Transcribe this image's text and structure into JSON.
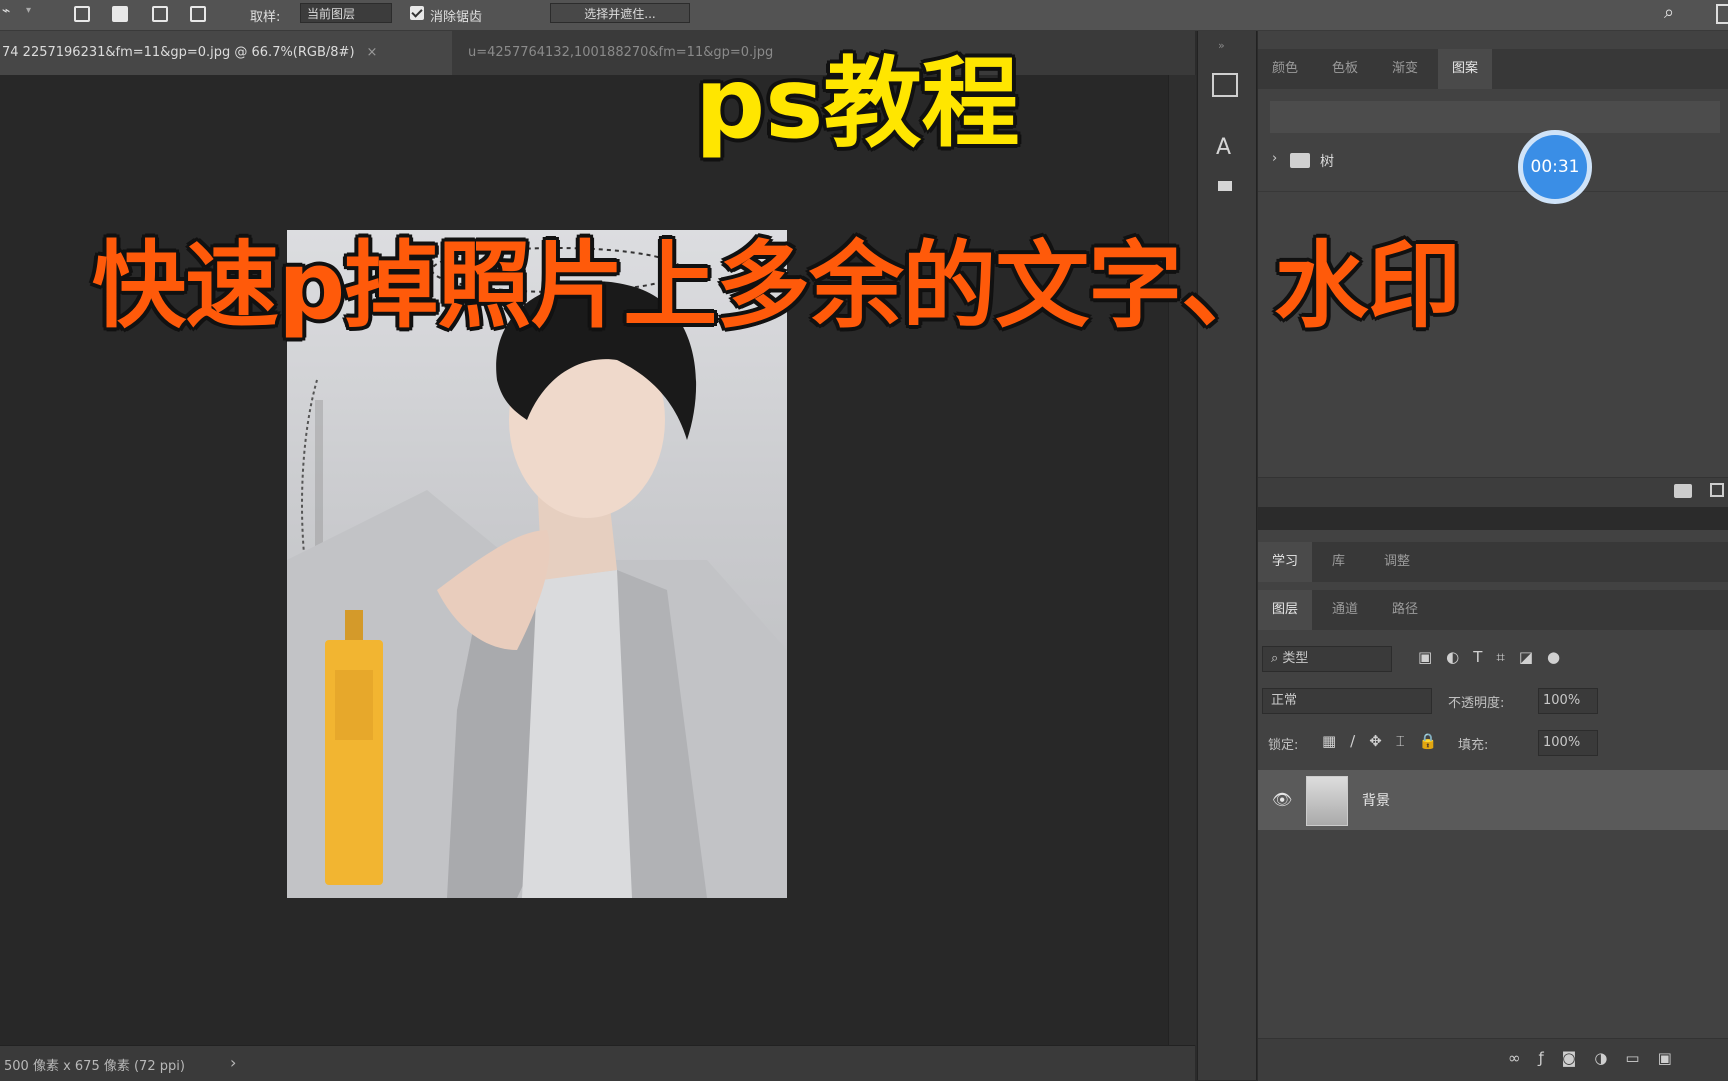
{
  "options_bar": {
    "sample_label": "取样:",
    "sample_value": "当前图层",
    "checkbox_label": "消除锯齿",
    "button_label": "选择并遮住..."
  },
  "document_tabs": [
    {
      "label": "74 2257196231&fm=11&gp=0.jpg @ 66.7%(RGB/8#)",
      "close": "×",
      "active": true
    },
    {
      "label": "u=4257764132,100188270&fm=11&gp=0.jpg",
      "close": "",
      "active": false
    }
  ],
  "status_bar": {
    "text": "500 像素 x 675 像素 (72 ppi)",
    "arrow": "›"
  },
  "overlay": {
    "title_line1": "ps教程",
    "title_line2": "快速p掉照片上多余的文字、水印",
    "timer": "00:31"
  },
  "upper_panel": {
    "tabs": [
      "颜色",
      "色板",
      "渐变",
      "图案"
    ],
    "active_tab": 3,
    "group_label": "树"
  },
  "layers_panel": {
    "tabs_row1": [
      "学习",
      "库",
      "调整"
    ],
    "tabs_row2": [
      "图层",
      "通道",
      "路径"
    ],
    "filter_label": "类型",
    "blend_mode": "正常",
    "opacity_label": "不透明度:",
    "opacity_value": "100%",
    "lock_label": "锁定:",
    "fill_label": "填充:",
    "fill_value": "100%",
    "layer_name": "背景"
  },
  "colors": {
    "title_yellow": "#ffe600",
    "title_orange": "#ff5a0a",
    "timer_blue": "#3a8ee6"
  }
}
